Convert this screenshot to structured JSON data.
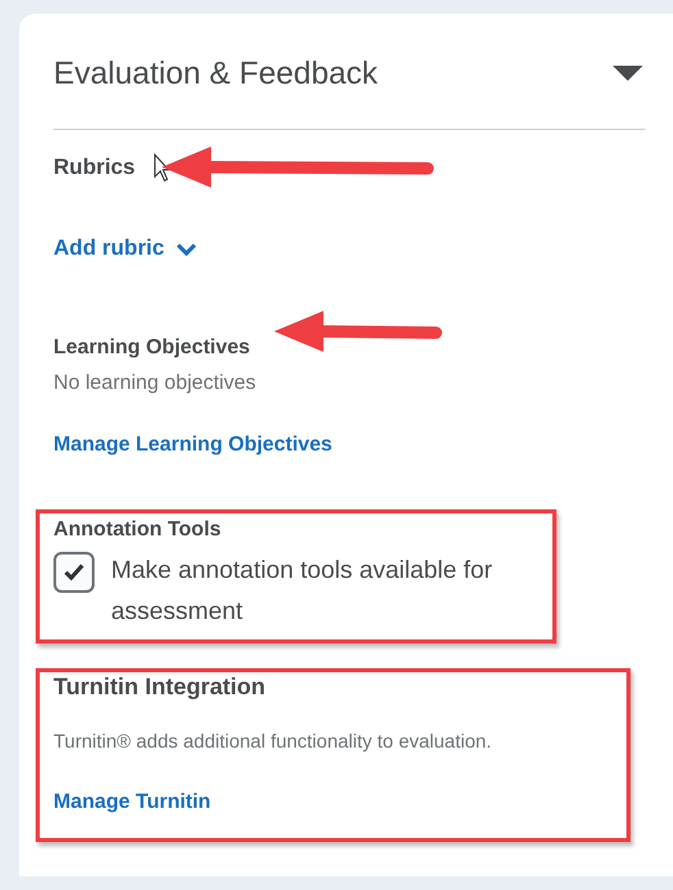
{
  "panel": {
    "title": "Evaluation & Feedback",
    "expanded": true
  },
  "rubrics": {
    "heading": "Rubrics",
    "add_link": "Add rubric"
  },
  "learning_objectives": {
    "heading": "Learning Objectives",
    "empty_text": "No learning objectives",
    "manage_link": "Manage Learning Objectives"
  },
  "annotation_tools": {
    "heading": "Annotation Tools",
    "checkbox": {
      "label": "Make annotation tools available for assessment",
      "checked": true
    }
  },
  "turnitin": {
    "heading": "Turnitin Integration",
    "description": "Turnitin® adds additional functionality to evaluation.",
    "manage_link": "Manage Turnitin"
  }
}
